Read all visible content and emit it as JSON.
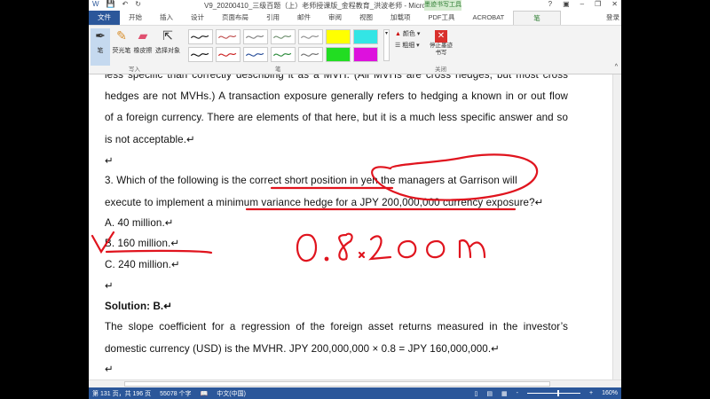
{
  "window": {
    "title": "V9_20200410_三级百题（上）老师授课版_金程教育_洪波老师 - Microsoft Word",
    "context_tab": "墨迹书写工具",
    "help": "?",
    "login": "登录"
  },
  "tabs": [
    "文件",
    "开始",
    "插入",
    "设计",
    "页面布局",
    "引用",
    "邮件",
    "审阅",
    "视图",
    "加载项",
    "PDF工具",
    "ACROBAT",
    "笔"
  ],
  "ribbon": {
    "tools": [
      "笔",
      "荧光笔",
      "橡皮擦",
      "选择对象"
    ],
    "write_group": "写入",
    "pens_group": "笔",
    "color": "颜色",
    "weight": "粗细",
    "stop": "停止墨迹书写",
    "close_group": "关闭",
    "pen_colors": [
      "#222222",
      "#c05050",
      "#808080",
      "#709070",
      "#909090",
      "#ffff00",
      "#33e5e5",
      "#111111",
      "#cc2222",
      "#2a4f9a",
      "#2a8a3a",
      "#707070",
      "#22dd22",
      "#dd11dd"
    ]
  },
  "document": {
    "lines": [
      "less specific than correctly describing it as a MVH. (All MVHs are cross hedges, but most cross",
      "hedges are not MVHs.) A transaction exposure generally refers to hedging a known in or out flow",
      "of a foreign currency. There are elements of that here, but it is a much less specific answer and so",
      "is not acceptable.↵",
      "↵",
      "3.      Which of the following is the correct short position in yen the managers at Garrison will",
      "         execute to implement a minimum variance hedge for a JPY 200,000,000 currency exposure?↵",
      "A.      40 million.↵",
      "B.      160 million.↵",
      "C.      240 million.↵",
      "↵",
      "Solution: B.↵",
      "The slope coefficient for a regression of the foreign asset returns measured in the investor’s",
      "domestic currency (USD) is the MVHR. JPY 200,000,000 × 0.8 = JPY 160,000,000.↵",
      "↵"
    ],
    "handwriting": "0.8 × 200 m"
  },
  "status": {
    "page": "第 131 页，共 196 页",
    "words": "55078 个字",
    "lang": "中文(中国)",
    "zoom": "160%"
  },
  "ink_color": "#e0141e"
}
